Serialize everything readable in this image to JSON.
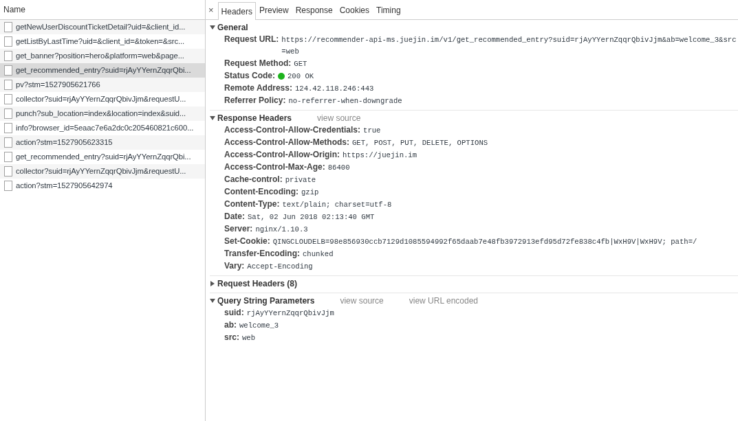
{
  "requests": {
    "column": "Name",
    "items": [
      {
        "name": "getNewUserDiscountTicketDetail?uid=&client_id...",
        "selected": false
      },
      {
        "name": "getListByLastTime?uid=&client_id=&token=&src...",
        "selected": false
      },
      {
        "name": "get_banner?position=hero&platform=web&page...",
        "selected": false
      },
      {
        "name": "get_recommended_entry?suid=rjAyYYernZqqrQbi...",
        "selected": true
      },
      {
        "name": "pv?stm=1527905621766",
        "selected": false
      },
      {
        "name": "collector?suid=rjAyYYernZqqrQbivJjm&requestU...",
        "selected": false
      },
      {
        "name": "punch?sub_location=index&location=index&suid...",
        "selected": false
      },
      {
        "name": "info?browser_id=5eaac7e6a2dc0c205460821c600...",
        "selected": false
      },
      {
        "name": "action?stm=1527905623315",
        "selected": false
      },
      {
        "name": "get_recommended_entry?suid=rjAyYYernZqqrQbi...",
        "selected": false
      },
      {
        "name": "collector?suid=rjAyYYernZqqrQbivJjm&requestU...",
        "selected": false
      },
      {
        "name": "action?stm=1527905642974",
        "selected": false
      }
    ]
  },
  "detail": {
    "close": "×",
    "tabs": [
      {
        "label": "Headers",
        "selected": true
      },
      {
        "label": "Preview",
        "selected": false
      },
      {
        "label": "Response",
        "selected": false
      },
      {
        "label": "Cookies",
        "selected": false
      },
      {
        "label": "Timing",
        "selected": false
      }
    ],
    "sections": [
      {
        "title": "General",
        "expanded": true,
        "rows": [
          {
            "name": "Request URL:",
            "value": "https://recommender-api-ms.juejin.im/v1/get_recommended_entry?suid=rjAyYYernZqqrQbivJjm&ab=welcome_3&src=web"
          },
          {
            "name": "Request Method:",
            "value": "GET"
          },
          {
            "name": "Status Code:",
            "value": "200 OK",
            "color": "#1db31d"
          },
          {
            "name": "Remote Address:",
            "value": "124.42.118.246:443"
          },
          {
            "name": "Referrer Policy:",
            "value": "no-referrer-when-downgrade"
          }
        ]
      },
      {
        "title": "Response Headers",
        "expanded": true,
        "links": [
          "view source"
        ],
        "rows": [
          {
            "name": "Access-Control-Allow-Credentials:",
            "value": "true"
          },
          {
            "name": "Access-Control-Allow-Methods:",
            "value": "GET, POST, PUT, DELETE, OPTIONS"
          },
          {
            "name": "Access-Control-Allow-Origin:",
            "value": "https://juejin.im"
          },
          {
            "name": "Access-Control-Max-Age:",
            "value": "86400"
          },
          {
            "name": "Cache-control:",
            "value": "private"
          },
          {
            "name": "Content-Encoding:",
            "value": "gzip"
          },
          {
            "name": "Content-Type:",
            "value": "text/plain; charset=utf-8"
          },
          {
            "name": "Date:",
            "value": "Sat, 02 Jun 2018 02:13:40 GMT"
          },
          {
            "name": "Server:",
            "value": "nginx/1.10.3"
          },
          {
            "name": "Set-Cookie:",
            "value": "QINGCLOUDELB=98e856930ccb7129d1085594992f65daab7e48fb3972913efd95d72fe838c4fb|WxH9V|WxH9V; path=/"
          },
          {
            "name": "Transfer-Encoding:",
            "value": "chunked"
          },
          {
            "name": "Vary:",
            "value": "Accept-Encoding"
          }
        ]
      },
      {
        "title": "Request Headers (8)",
        "expanded": false
      },
      {
        "title": "Query String Parameters",
        "expanded": true,
        "links": [
          "view source",
          "view URL encoded"
        ],
        "rows": [
          {
            "name": "suid:",
            "value": "rjAyYYernZqqrQbivJjm"
          },
          {
            "name": "ab:",
            "value": "welcome_3"
          },
          {
            "name": "src:",
            "value": "web"
          }
        ]
      }
    ]
  }
}
